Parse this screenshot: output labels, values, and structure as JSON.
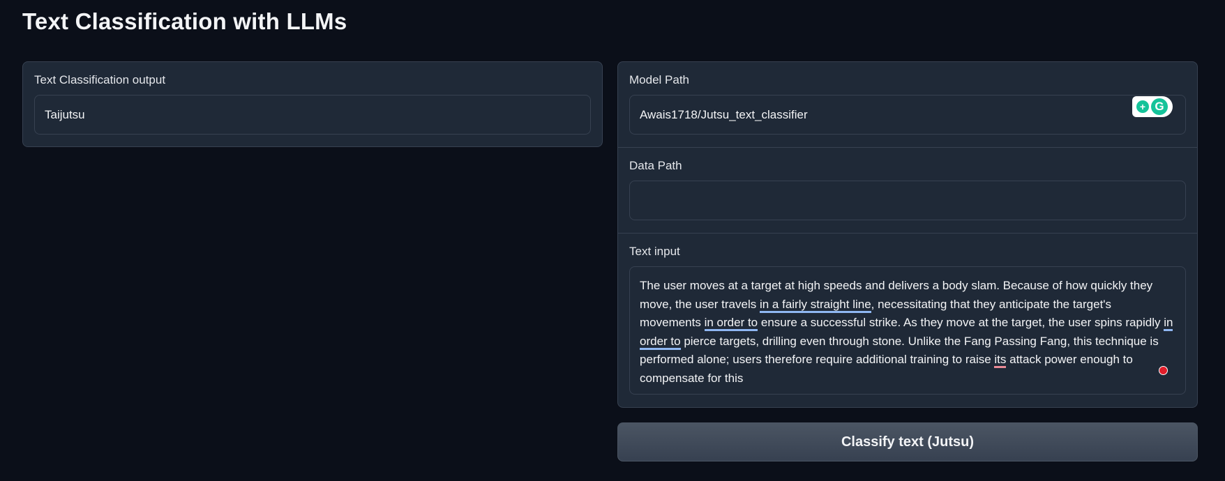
{
  "page": {
    "title": "Text Classification with LLMs"
  },
  "output_panel": {
    "label": "Text Classification output",
    "value": "Taijutsu"
  },
  "model_path": {
    "label": "Model Path",
    "value": "Awais1718/Jutsu_text_classifier"
  },
  "data_path": {
    "label": "Data Path",
    "value": ""
  },
  "text_input": {
    "label": "Text input",
    "segments": [
      "The user moves at a target at high speeds and delivers a body slam. Because of how quickly they move, the user travels ",
      "in a fairly straight line",
      ", necessitating that they anticipate the target's movements ",
      "in order to",
      " ensure a successful strike. As they move at the target, the user spins rapidly ",
      "in order to",
      " pierce targets, drilling even through stone. Unlike the Fang Passing Fang, this technique is performed alone; users therefore require additional training to raise ",
      "its",
      " attack power enough to compensate for this"
    ]
  },
  "classify_button": {
    "label": "Classify text (Jutsu)"
  },
  "icons": {
    "grammarly": "grammarly-icon",
    "grammarly_suggest": "lightbulb-plus-icon",
    "error_dot": "grammar-error-indicator-icon"
  },
  "colors": {
    "background": "#0b0f19",
    "panel": "#1f2937",
    "border": "#374151",
    "underline_suggestion": "#8fb7f2",
    "underline_error": "#e88a96",
    "grammarly_green": "#15c39a",
    "error_red": "#e11d2a"
  }
}
